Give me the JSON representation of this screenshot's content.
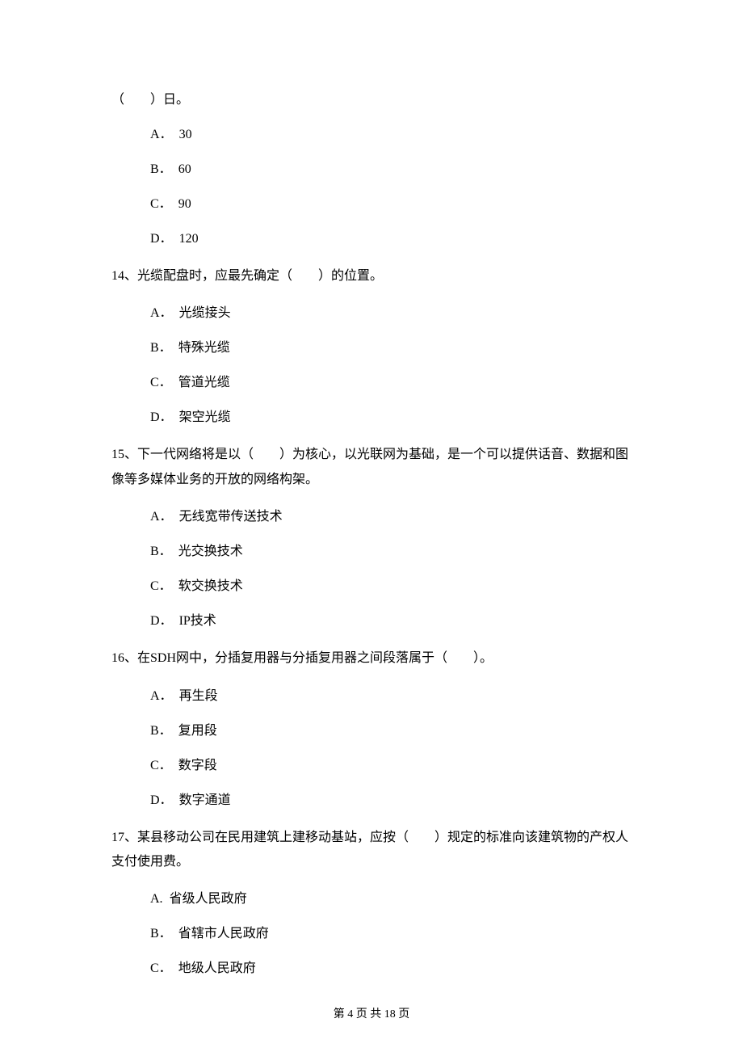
{
  "continuation": "（　　）日。",
  "q13_remaining_options": [
    {
      "label": "A．",
      "text": "30"
    },
    {
      "label": "B．",
      "text": "60"
    },
    {
      "label": "C．",
      "text": "90"
    },
    {
      "label": "D．",
      "text": "120"
    }
  ],
  "q14": {
    "stem": "14、光缆配盘时，应最先确定（　　）的位置。",
    "options": [
      {
        "label": "A．",
        "text": "光缆接头"
      },
      {
        "label": "B．",
        "text": "特殊光缆"
      },
      {
        "label": "C．",
        "text": "管道光缆"
      },
      {
        "label": "D．",
        "text": "架空光缆"
      }
    ]
  },
  "q15": {
    "stem": "15、下一代网络将是以（　　）为核心，以光联网为基础，是一个可以提供话音、数据和图像等多媒体业务的开放的网络构架。",
    "options": [
      {
        "label": "A．",
        "text": "无线宽带传送技术"
      },
      {
        "label": "B．",
        "text": "光交换技术"
      },
      {
        "label": "C．",
        "text": "软交换技术"
      },
      {
        "label": "D．",
        "text": "IP技术"
      }
    ]
  },
  "q16": {
    "stem": "16、在SDH网中，分插复用器与分插复用器之间段落属于（　　）。",
    "options": [
      {
        "label": "A．",
        "text": "再生段"
      },
      {
        "label": "B．",
        "text": "复用段"
      },
      {
        "label": "C．",
        "text": "数字段"
      },
      {
        "label": "D．",
        "text": "数字通道"
      }
    ]
  },
  "q17": {
    "stem": "17、某县移动公司在民用建筑上建移动基站，应按（　　）规定的标准向该建筑物的产权人支付使用费。",
    "options": [
      {
        "label": "A.",
        "text": "省级人民政府"
      },
      {
        "label": "B．",
        "text": "省辖市人民政府"
      },
      {
        "label": "C．",
        "text": "地级人民政府"
      }
    ]
  },
  "footer": "第 4 页 共 18 页"
}
